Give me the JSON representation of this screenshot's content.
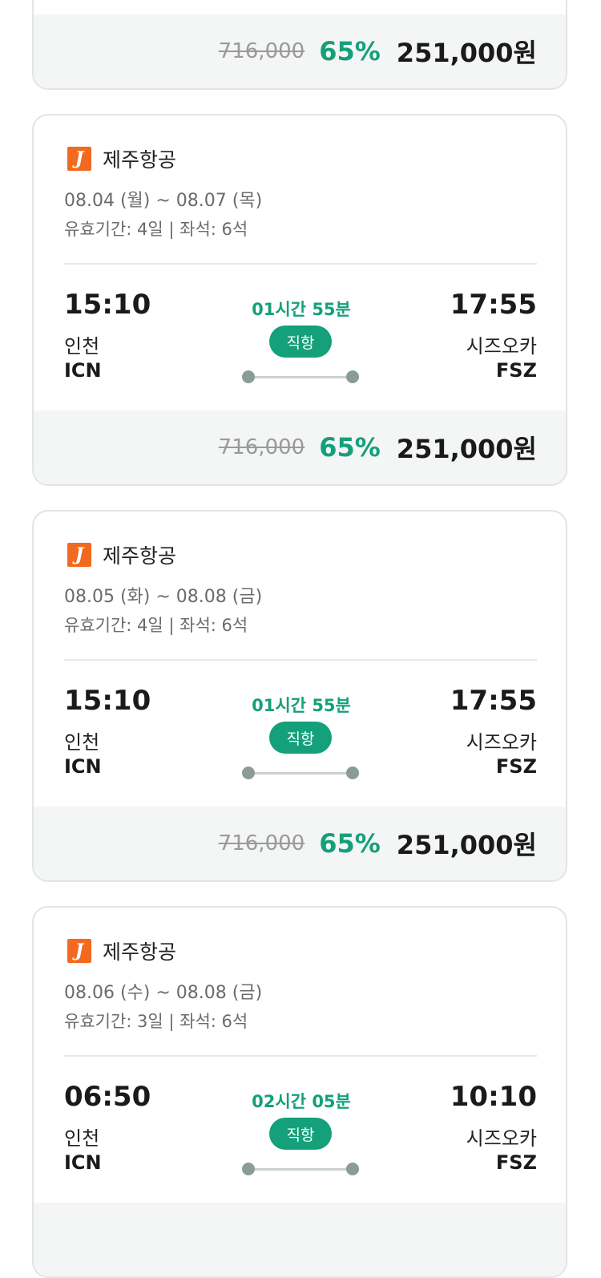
{
  "partial_top": {
    "original_price": "716,000",
    "discount": "65%",
    "final_price": "251,000원"
  },
  "cards": [
    {
      "airline": "제주항공",
      "logo_letter": "J",
      "dates": "08.04 (월) ~ 08.07 (목)",
      "validity": "유효기간: 4일 | 좌석: 6석",
      "dep_time": "15:10",
      "dep_city": "인천",
      "dep_code": "ICN",
      "duration": "01시간 55분",
      "type": "직항",
      "arr_time": "17:55",
      "arr_city": "시즈오카",
      "arr_code": "FSZ",
      "original_price": "716,000",
      "discount": "65%",
      "final_price": "251,000원"
    },
    {
      "airline": "제주항공",
      "logo_letter": "J",
      "dates": "08.05 (화) ~ 08.08 (금)",
      "validity": "유효기간: 4일 | 좌석: 6석",
      "dep_time": "15:10",
      "dep_city": "인천",
      "dep_code": "ICN",
      "duration": "01시간 55분",
      "type": "직항",
      "arr_time": "17:55",
      "arr_city": "시즈오카",
      "arr_code": "FSZ",
      "original_price": "716,000",
      "discount": "65%",
      "final_price": "251,000원"
    },
    {
      "airline": "제주항공",
      "logo_letter": "J",
      "dates": "08.06 (수) ~ 08.08 (금)",
      "validity": "유효기간: 3일 | 좌석: 6석",
      "dep_time": "06:50",
      "dep_city": "인천",
      "dep_code": "ICN",
      "duration": "02시간 05분",
      "type": "직항",
      "arr_time": "10:10",
      "arr_city": "시즈오카",
      "arr_code": "FSZ"
    }
  ],
  "colors": {
    "accent": "#14a07a",
    "logo": "#f26a1f",
    "price_bar_bg": "#f4f5f5",
    "border": "#e2e4e5"
  }
}
